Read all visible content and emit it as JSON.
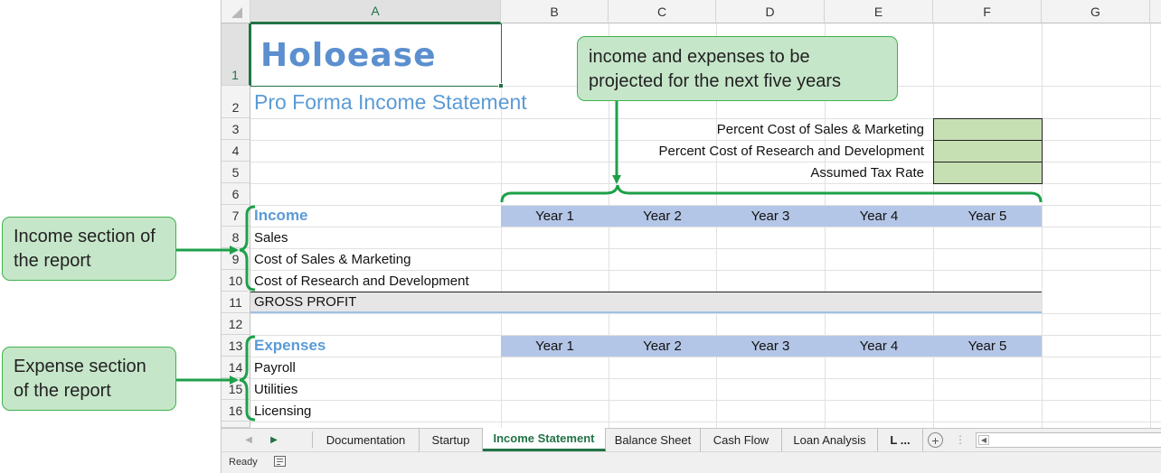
{
  "spreadsheet": {
    "columns": [
      "A",
      "B",
      "C",
      "D",
      "E",
      "F",
      "G"
    ],
    "rows": [
      "1",
      "2",
      "3",
      "4",
      "5",
      "6",
      "7",
      "8",
      "9",
      "10",
      "11",
      "12",
      "13",
      "14",
      "15",
      "16"
    ],
    "title": "Holoease",
    "subtitle": "Pro Forma Income Statement",
    "assumptions": [
      "Percent Cost of Sales & Marketing",
      "Percent Cost of Research and Development",
      "Assumed Tax Rate"
    ],
    "income_heading": "Income",
    "income_items": [
      "Sales",
      "Cost of Sales & Marketing",
      "Cost of Research and Development"
    ],
    "gross_profit": "GROSS PROFIT",
    "expenses_heading": "Expenses",
    "expense_items": [
      "Payroll",
      "Utilities",
      "Licensing"
    ],
    "years": [
      "Year 1",
      "Year 2",
      "Year 3",
      "Year 4",
      "Year 5"
    ]
  },
  "sheet_tabs": {
    "items": [
      "Documentation",
      "Startup",
      "Income Statement",
      "Balance Sheet",
      "Cash Flow",
      "Loan Analysis",
      "L ..."
    ],
    "active": "Income Statement"
  },
  "status": {
    "ready": "Ready"
  },
  "callouts": {
    "top": "income and expenses to be projected for the next five years",
    "income": "Income section of the report",
    "expense": "Expense section of the report"
  },
  "colors": {
    "accent_green": "#217346",
    "callout_fill": "#c6e6c9",
    "callout_border": "#3fb24f",
    "year_header_fill": "#b4c6e7",
    "input_fill": "#c6e0b4",
    "title_blue": "#5b8fcf"
  }
}
